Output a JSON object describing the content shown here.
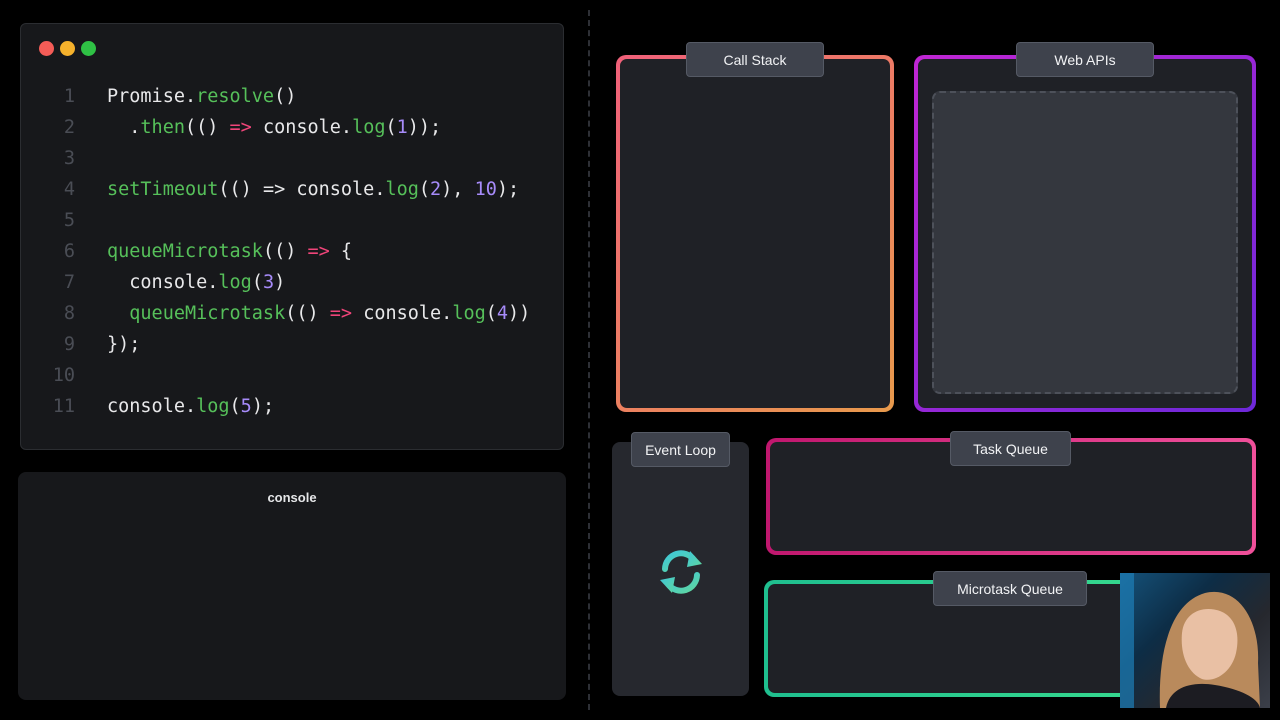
{
  "editor": {
    "window_dots": [
      "#f45c57",
      "#f5b12c",
      "#2fc145"
    ],
    "lines": [
      {
        "num": "1",
        "tokens": [
          {
            "t": "Promise.",
            "c": "plain"
          },
          {
            "t": "resolve",
            "c": "fn"
          },
          {
            "t": "()",
            "c": "plain"
          }
        ]
      },
      {
        "num": "2",
        "tokens": [
          {
            "t": "  .",
            "c": "plain"
          },
          {
            "t": "then",
            "c": "fn"
          },
          {
            "t": "(() ",
            "c": "plain"
          },
          {
            "t": "=>",
            "c": "kw"
          },
          {
            "t": " console.",
            "c": "plain"
          },
          {
            "t": "log",
            "c": "fn"
          },
          {
            "t": "(",
            "c": "plain"
          },
          {
            "t": "1",
            "c": "num"
          },
          {
            "t": "));",
            "c": "plain"
          }
        ]
      },
      {
        "num": "3",
        "tokens": []
      },
      {
        "num": "4",
        "tokens": [
          {
            "t": "setTimeout",
            "c": "fn"
          },
          {
            "t": "(() => console.",
            "c": "plain"
          },
          {
            "t": "log",
            "c": "fn"
          },
          {
            "t": "(",
            "c": "plain"
          },
          {
            "t": "2",
            "c": "num"
          },
          {
            "t": "), ",
            "c": "plain"
          },
          {
            "t": "10",
            "c": "num"
          },
          {
            "t": ");",
            "c": "plain"
          }
        ]
      },
      {
        "num": "5",
        "tokens": []
      },
      {
        "num": "6",
        "tokens": [
          {
            "t": "queueMicrotask",
            "c": "fn"
          },
          {
            "t": "(() ",
            "c": "plain"
          },
          {
            "t": "=>",
            "c": "kw"
          },
          {
            "t": " {",
            "c": "plain"
          }
        ]
      },
      {
        "num": "7",
        "tokens": [
          {
            "t": "  console.",
            "c": "plain"
          },
          {
            "t": "log",
            "c": "fn"
          },
          {
            "t": "(",
            "c": "plain"
          },
          {
            "t": "3",
            "c": "num"
          },
          {
            "t": ")",
            "c": "plain"
          }
        ]
      },
      {
        "num": "8",
        "tokens": [
          {
            "t": "  queueMicrotask",
            "c": "fn"
          },
          {
            "t": "(() ",
            "c": "plain"
          },
          {
            "t": "=>",
            "c": "kw"
          },
          {
            "t": " console.",
            "c": "plain"
          },
          {
            "t": "log",
            "c": "fn"
          },
          {
            "t": "(",
            "c": "plain"
          },
          {
            "t": "4",
            "c": "num"
          },
          {
            "t": "))",
            "c": "plain"
          }
        ]
      },
      {
        "num": "9",
        "tokens": [
          {
            "t": "});",
            "c": "plain"
          }
        ]
      },
      {
        "num": "10",
        "tokens": []
      },
      {
        "num": "11",
        "tokens": [
          {
            "t": "console.",
            "c": "plain"
          },
          {
            "t": "log",
            "c": "fn"
          },
          {
            "t": "(",
            "c": "plain"
          },
          {
            "t": "5",
            "c": "num"
          },
          {
            "t": ");",
            "c": "plain"
          }
        ]
      }
    ]
  },
  "console": {
    "title": "console"
  },
  "diagram": {
    "call_stack": "Call Stack",
    "web_apis": "Web APIs",
    "event_loop": "Event Loop",
    "task_queue": "Task Queue",
    "microtask_queue": "Microtask Queue",
    "event_loop_icon": "refresh-cycle-icon"
  },
  "colors": {
    "call_stack_border": [
      "#f0607a",
      "#e89a4c"
    ],
    "web_apis_border": [
      "#c026d3",
      "#6d28d9"
    ],
    "task_queue_border": [
      "#c0176e",
      "#f0509a"
    ],
    "microtask_queue_border": [
      "#1fbf8f",
      "#3de08e"
    ],
    "event_loop_icon": [
      "#3ec7d8",
      "#5fd6a0"
    ]
  },
  "webcam": {
    "subject": "presenter-webcam-overlay"
  }
}
